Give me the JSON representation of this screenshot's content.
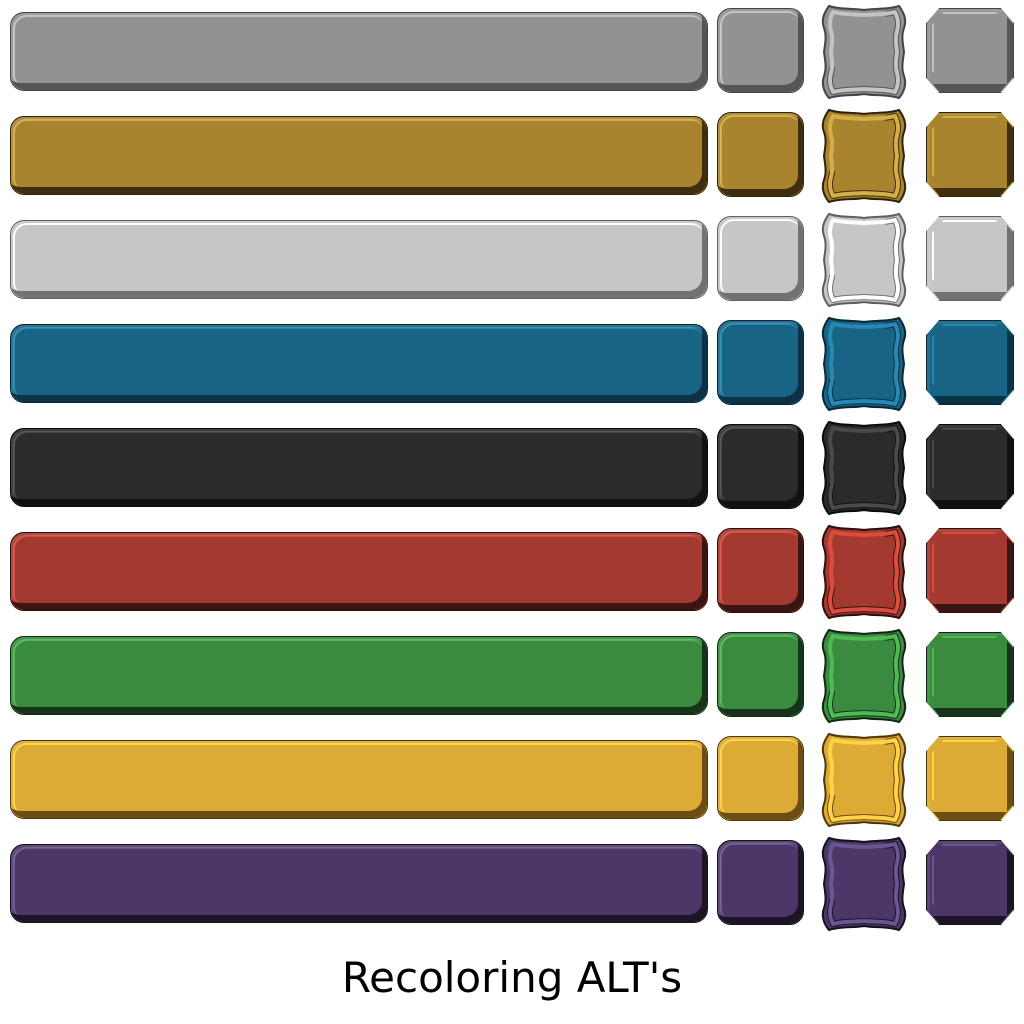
{
  "caption": "Recoloring ALT's",
  "rows": [
    {
      "name": "gray",
      "fill": "#929292",
      "highlight": "#c4c4c4",
      "shadow": "#555555",
      "outline": "#444444"
    },
    {
      "name": "gold",
      "fill": "#a8842f",
      "highlight": "#d6ae49",
      "shadow": "#3f2f10",
      "outline": "#2e220b"
    },
    {
      "name": "silver",
      "fill": "#c6c6c6",
      "highlight": "#ffffff",
      "shadow": "#727272",
      "outline": "#5f5f5f"
    },
    {
      "name": "blue",
      "fill": "#176485",
      "highlight": "#2a88b0",
      "shadow": "#0b3246",
      "outline": "#0a2736"
    },
    {
      "name": "black",
      "fill": "#2b2b2b",
      "highlight": "#4a4a4a",
      "shadow": "#111111",
      "outline": "#0b0b0b"
    },
    {
      "name": "red",
      "fill": "#a3392f",
      "highlight": "#db4c40",
      "shadow": "#3b1511",
      "outline": "#2b0f0c"
    },
    {
      "name": "green",
      "fill": "#3a8a40",
      "highlight": "#4fb956",
      "shadow": "#173319",
      "outline": "#112613"
    },
    {
      "name": "yellow",
      "fill": "#dcab35",
      "highlight": "#ffd347",
      "shadow": "#6d4d13",
      "outline": "#4c360e"
    },
    {
      "name": "purple",
      "fill": "#4b3868",
      "highlight": "#6a5693",
      "shadow": "#1d1526",
      "outline": "#15101c"
    }
  ]
}
